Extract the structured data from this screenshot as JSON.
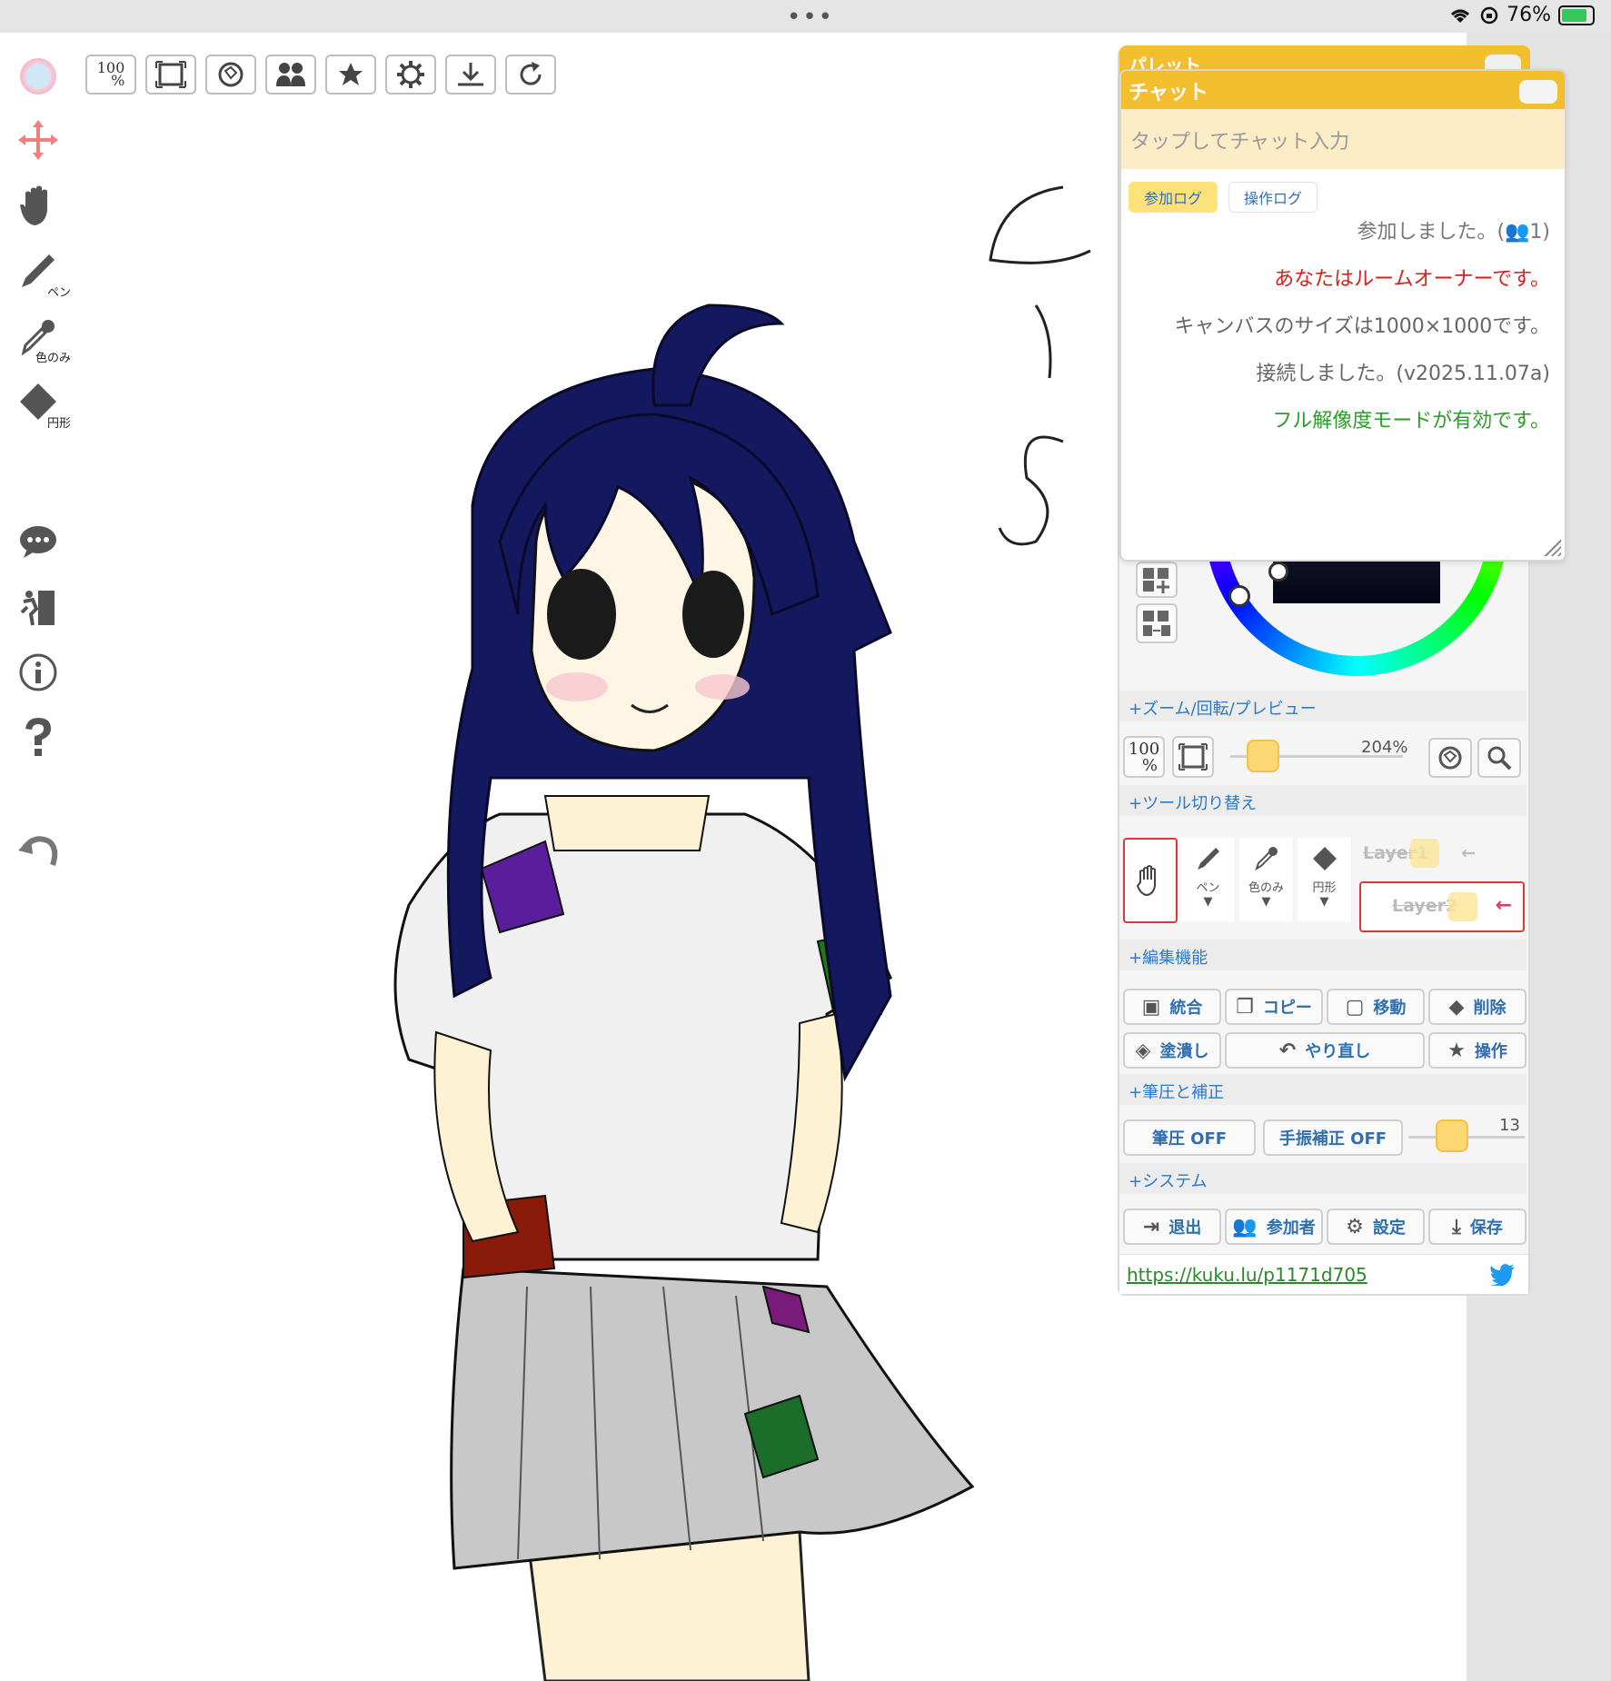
{
  "status_bar": {
    "dots": "•••",
    "battery": "76%"
  },
  "top_toolbar": {
    "zoom_100_line1": "100",
    "zoom_100_line2": "%"
  },
  "left_tools": {
    "pen_label": "ペン",
    "eyedropper_label": "色のみ",
    "eraser_label": "円形"
  },
  "palette": {
    "title": "パレット"
  },
  "chat": {
    "title": "チャット",
    "input_placeholder": "タップしてチャット入力",
    "tabs": [
      "参加ログ",
      "操作ログ"
    ],
    "active_tab": "参加ログ",
    "messages": [
      {
        "text": "参加しました。(👥1)",
        "color": "#777777"
      },
      {
        "text": "あなたはルームオーナーです。",
        "color": "#d62020"
      },
      {
        "text": "キャンバスのサイズは1000×1000です。",
        "color": "#666666"
      },
      {
        "text": "接続しました。(v2025.11.07a)",
        "color": "#666666"
      },
      {
        "text": "フル解像度モードが有効です。",
        "color": "#2a9d2a"
      }
    ]
  },
  "zoom_section": {
    "title": "+ズーム/回転/プレビュー",
    "zoom_value": "204%",
    "btn_100_line1": "100",
    "btn_100_line2": "%"
  },
  "tool_switch": {
    "title": "+ツール切り替え",
    "tools": [
      "ペン",
      "色のみ",
      "円形"
    ],
    "layers": [
      "Layer1",
      "Layer2"
    ]
  },
  "edit": {
    "title": "+編集機能",
    "buttons_row1": [
      "統合",
      "コピー",
      "移動",
      "削除"
    ],
    "buttons_row2": [
      "塗潰し",
      "やり直し",
      "操作"
    ]
  },
  "pressure": {
    "title": "+筆圧と補正",
    "pressure_btn": "筆圧 OFF",
    "stabilizer_btn": "手振補正 OFF",
    "brush_size": "13"
  },
  "system": {
    "title": "+システム",
    "buttons": [
      "退出",
      "参加者",
      "設定",
      "保存"
    ]
  },
  "footer": {
    "url": "https://kuku.lu/p1171d705"
  },
  "colors": {
    "accent": "#f4bf2f",
    "link": "#2c79c4",
    "twitter": "#1d9bf0"
  }
}
